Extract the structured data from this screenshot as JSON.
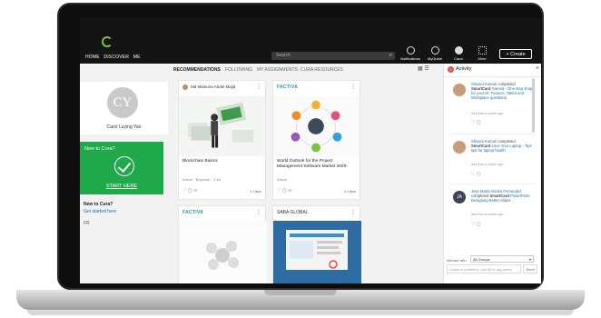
{
  "topbar": {
    "nav": [
      "HOME",
      "DISCOVER",
      "ME"
    ],
    "search_placeholder": "Search",
    "notifications_label": "Notifications",
    "myguide_label": "MyGuide",
    "user_label": "Carol",
    "more_label": "More",
    "create_label": "+ Create"
  },
  "tabs": [
    "RECOMMENDATIONS",
    "FOLLOWING",
    "MY ASSIGNMENTS",
    "CURA RESOURCES"
  ],
  "profile": {
    "initials": "CY",
    "name": "Carol Luying Yan"
  },
  "new_to_cura": {
    "title": "New to Cura?",
    "cta": "START HERE",
    "question": "New to Cura?",
    "link": "Get started here",
    "extra": "FR"
  },
  "cards": [
    {
      "author": "Md Mainuna Abdel Majid",
      "title": "Blockchain Basics",
      "meta": "Article · Beginner · 5 Mi",
      "likes": "4 Likes"
    },
    {
      "source": "FACTIVA",
      "title": "World Outlook for the Project Management Software Market 2020-",
      "meta": "Article",
      "likes": "2 Likes"
    },
    {
      "source": "FACTIVA"
    },
    {
      "source": "SABA GLOBAL"
    }
  ],
  "activity": {
    "badge": "1",
    "title": "Activity",
    "items": [
      {
        "name": "Shivani Kumari",
        "action": "completed",
        "kind": "SmartCard",
        "text": "Gamed - One stop shop for your KI, Finance, Talent and Workplace questions",
        "time": "less than a minute ago"
      },
      {
        "name": "Shivani Kumari",
        "action": "completed",
        "kind": "SmartCard",
        "text": "Love Your Laptop - Tips tips for laptop health",
        "time": "less than a minute ago"
      },
      {
        "initials": "JA",
        "name": "Jose Maria Alonso Fernandez",
        "action": "completed",
        "kind": "SmartCard",
        "text": "PowerPoint Designing Better Slides",
        "time": "less than a minute ago"
      }
    ],
    "interact_label": "Interact with",
    "interact_value": "All Groups",
    "comment_placeholder": "Leave a comment. Use @ to tag peers",
    "send_label": "Send"
  }
}
